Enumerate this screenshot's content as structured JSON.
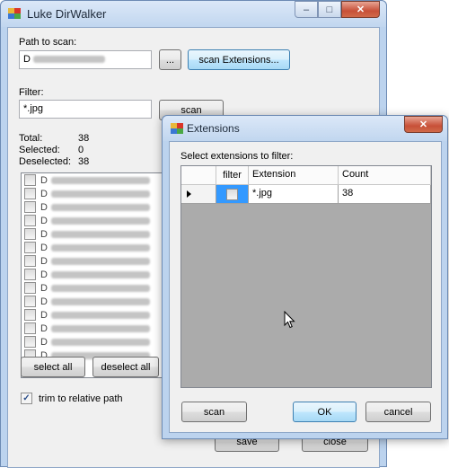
{
  "main": {
    "title": "Luke DirWalker",
    "path_label": "Path to scan:",
    "path_value_prefix": "D",
    "browse_label": "...",
    "scan_ext_label": "scan Extensions...",
    "filter_label": "Filter:",
    "filter_value": "*.jpg",
    "scan_label": "scan",
    "stats": {
      "total_label": "Total:",
      "total": "38",
      "selected_label": "Selected:",
      "selected": "0",
      "deselected_label": "Deselected:",
      "deselected": "38"
    },
    "file_items": [
      "D",
      "D",
      "D",
      "D",
      "D",
      "D",
      "D",
      "D",
      "D",
      "D",
      "D",
      "D",
      "D",
      "D"
    ],
    "select_all_label": "select all",
    "deselect_all_label": "deselect all",
    "trim_label": "trim to relative path",
    "trim_checked": true,
    "save_label": "save",
    "close_label": "close"
  },
  "dialog": {
    "title": "Extensions",
    "prompt": "Select extensions to filter:",
    "columns": [
      "filter",
      "Extension",
      "Count"
    ],
    "rows": [
      {
        "filter": false,
        "extension": "*.jpg",
        "count": "38"
      }
    ],
    "scan_label": "scan",
    "ok_label": "OK",
    "cancel_label": "cancel"
  },
  "window_buttons": {
    "minimize": "–",
    "maximize": "□",
    "close": "✕"
  },
  "colors": {
    "window_frame": "#bcd3ee",
    "close_button": "#c75038",
    "grid_empty": "#ababab"
  }
}
